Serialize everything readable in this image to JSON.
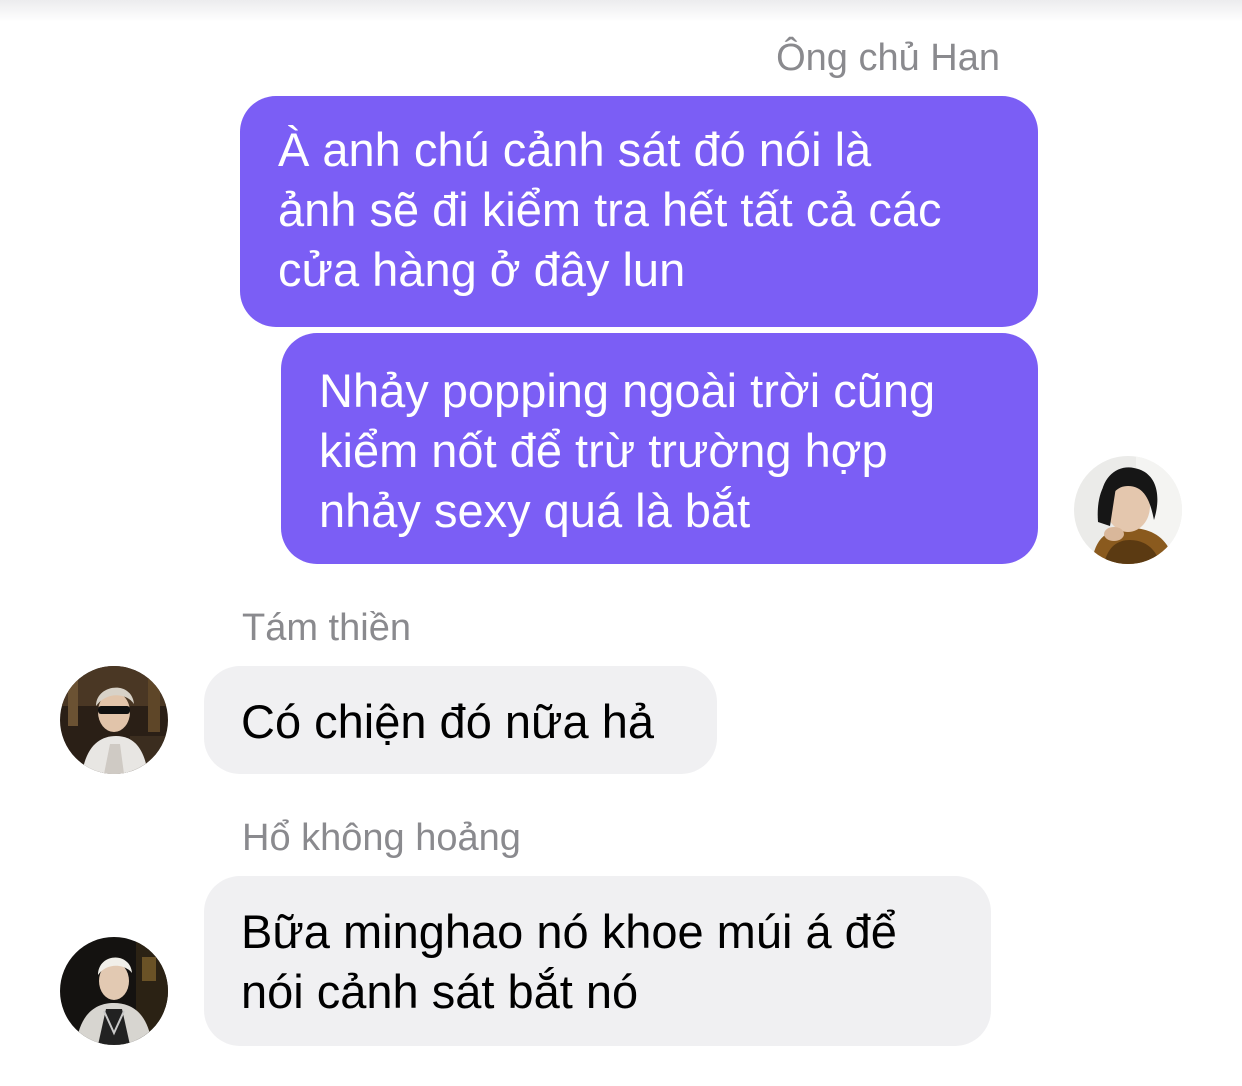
{
  "colors": {
    "outgoing_bubble": "#7b5ef5",
    "incoming_bubble": "#f0f0f2",
    "sender_name": "#8a8a8e"
  },
  "messages": [
    {
      "sender": "Ông chủ Han",
      "direction": "outgoing",
      "bubbles": [
        {
          "lines": [
            "À anh chú cảnh sát đó nói là",
            "ảnh sẽ đi kiểm tra hết tất cả các",
            "cửa hàng ở đây lun"
          ]
        },
        {
          "lines": [
            "Nhảy popping ngoài trời cũng",
            "kiểm nốt để trừ trường hợp",
            "nhảy sexy quá là bắt"
          ]
        }
      ]
    },
    {
      "sender": "Tám thiền",
      "direction": "incoming",
      "bubbles": [
        {
          "lines": [
            "Có chiện đó nữa hả"
          ]
        }
      ]
    },
    {
      "sender": "Hổ không hoảng",
      "direction": "incoming",
      "bubbles": [
        {
          "lines": [
            "Bữa minghao nó khoe múi á để",
            "nói cảnh sát bắt nó"
          ]
        }
      ]
    }
  ]
}
